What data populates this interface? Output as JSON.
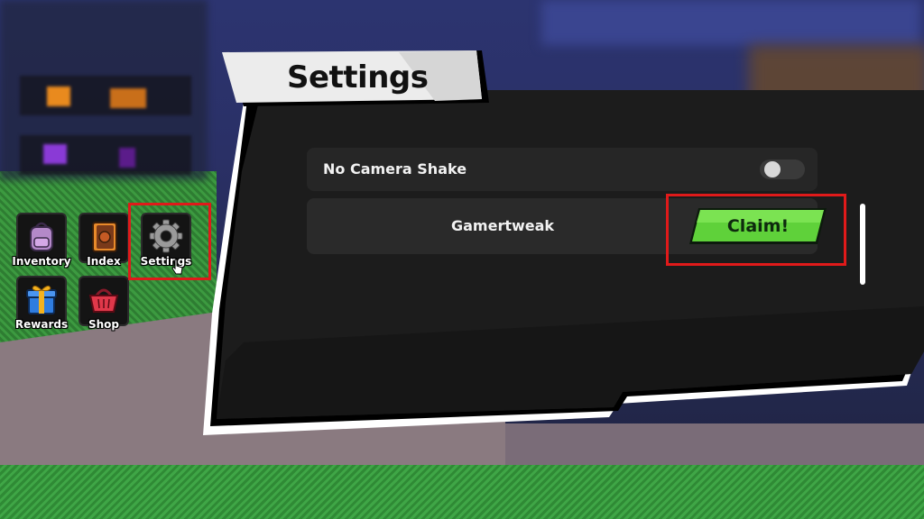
{
  "panel": {
    "title": "Settings",
    "rows": [
      {
        "label": "No Camera Shake",
        "control": "toggle",
        "state": "off"
      },
      {
        "label": "Gamertweak",
        "control": "button",
        "button_label": "Claim!"
      }
    ]
  },
  "menu": {
    "items": [
      {
        "label": "Inventory",
        "icon": "backpack-icon"
      },
      {
        "label": "Index",
        "icon": "book-icon"
      },
      {
        "label": "Settings",
        "icon": "gear-icon"
      },
      {
        "label": "Rewards",
        "icon": "gift-icon"
      },
      {
        "label": "Shop",
        "icon": "basket-icon"
      }
    ]
  },
  "colors": {
    "highlight": "#e01a1a",
    "claim_green": "#5fd13a",
    "panel_bg": "#1c1c1c"
  }
}
